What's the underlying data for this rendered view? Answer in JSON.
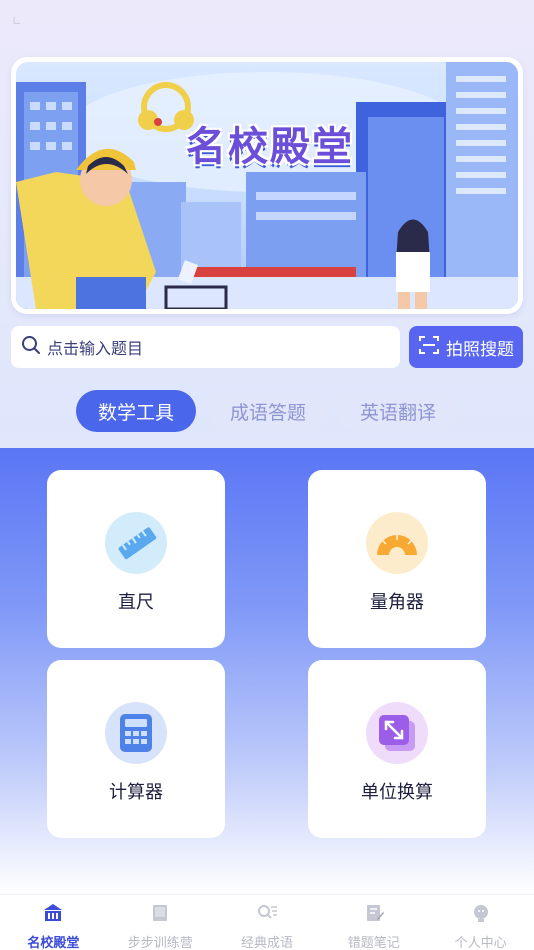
{
  "banner": {
    "title": "名校殿堂"
  },
  "search": {
    "placeholder": "点击输入题目",
    "photo_button": "拍照搜题"
  },
  "tabs": [
    {
      "label": "数学工具",
      "active": true
    },
    {
      "label": "成语答题",
      "active": false
    },
    {
      "label": "英语翻译",
      "active": false
    }
  ],
  "tools": [
    {
      "label": "直尺",
      "icon": "ruler-icon"
    },
    {
      "label": "量角器",
      "icon": "protractor-icon"
    },
    {
      "label": "计算器",
      "icon": "calculator-icon"
    },
    {
      "label": "单位换算",
      "icon": "unit-convert-icon"
    }
  ],
  "nav": [
    {
      "label": "名校殿堂",
      "icon": "school-icon",
      "active": true
    },
    {
      "label": "步步训练营",
      "icon": "book-icon",
      "active": false
    },
    {
      "label": "经典成语",
      "icon": "search-list-icon",
      "active": false
    },
    {
      "label": "错题笔记",
      "icon": "notes-icon",
      "active": false
    },
    {
      "label": "个人中心",
      "icon": "user-icon",
      "active": false
    }
  ],
  "colors": {
    "accent": "#4a66ea",
    "panel": "#5a76f5",
    "nav_active": "#3c4bd8"
  }
}
